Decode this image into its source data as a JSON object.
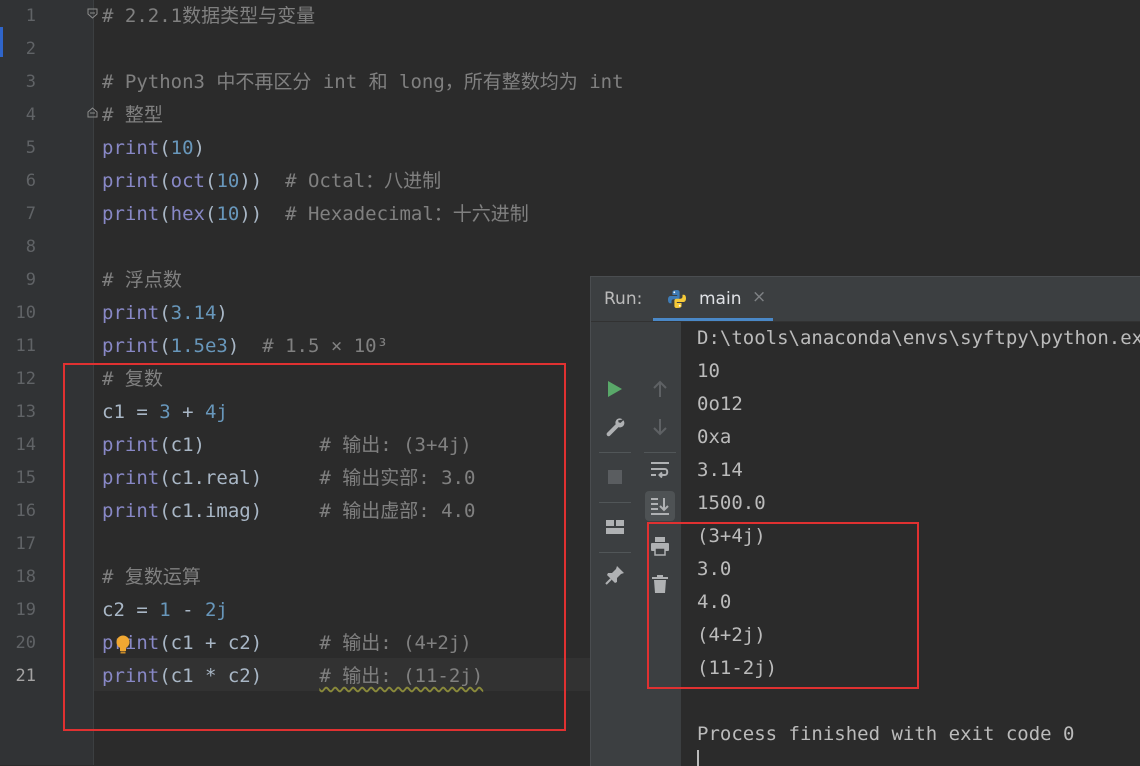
{
  "editor": {
    "line_numbers": [
      "1",
      "2",
      "3",
      "4",
      "5",
      "6",
      "7",
      "8",
      "9",
      "10",
      "11",
      "12",
      "13",
      "14",
      "15",
      "16",
      "17",
      "18",
      "19",
      "20",
      "21"
    ],
    "current_line": "21",
    "lines": [
      [
        {
          "t": "# 2.2.1数据类型与变量",
          "c": "cmt"
        }
      ],
      [],
      [
        {
          "t": "# Python3 中不再区分 int 和 long，所有整数均为 int",
          "c": "cmt"
        }
      ],
      [
        {
          "t": "# 整型",
          "c": "cmt"
        }
      ],
      [
        {
          "t": "print",
          "c": "kw"
        },
        {
          "t": "(",
          "c": "plain"
        },
        {
          "t": "10",
          "c": "num"
        },
        {
          "t": ")",
          "c": "plain"
        }
      ],
      [
        {
          "t": "print",
          "c": "kw"
        },
        {
          "t": "(",
          "c": "plain"
        },
        {
          "t": "oct",
          "c": "kw"
        },
        {
          "t": "(",
          "c": "plain"
        },
        {
          "t": "10",
          "c": "num"
        },
        {
          "t": "))  ",
          "c": "plain"
        },
        {
          "t": "# Octal：八进制",
          "c": "cmt"
        }
      ],
      [
        {
          "t": "print",
          "c": "kw"
        },
        {
          "t": "(",
          "c": "plain"
        },
        {
          "t": "hex",
          "c": "kw"
        },
        {
          "t": "(",
          "c": "plain"
        },
        {
          "t": "10",
          "c": "num"
        },
        {
          "t": "))  ",
          "c": "plain"
        },
        {
          "t": "# Hexadecimal：十六进制",
          "c": "cmt"
        }
      ],
      [],
      [
        {
          "t": "# 浮点数",
          "c": "cmt"
        }
      ],
      [
        {
          "t": "print",
          "c": "kw"
        },
        {
          "t": "(",
          "c": "plain"
        },
        {
          "t": "3.14",
          "c": "num"
        },
        {
          "t": ")",
          "c": "plain"
        }
      ],
      [
        {
          "t": "print",
          "c": "kw"
        },
        {
          "t": "(",
          "c": "plain"
        },
        {
          "t": "1.5e3",
          "c": "num"
        },
        {
          "t": ")  ",
          "c": "plain"
        },
        {
          "t": "# 1.5 × 10³",
          "c": "cmt"
        }
      ],
      [
        {
          "t": "# 复数",
          "c": "cmt"
        }
      ],
      [
        {
          "t": "c1 = ",
          "c": "plain"
        },
        {
          "t": "3",
          "c": "num"
        },
        {
          "t": " + ",
          "c": "plain"
        },
        {
          "t": "4j",
          "c": "num"
        }
      ],
      [
        {
          "t": "print",
          "c": "kw"
        },
        {
          "t": "(c1)          ",
          "c": "plain"
        },
        {
          "t": "# 输出: (3+4j)",
          "c": "cmt"
        }
      ],
      [
        {
          "t": "print",
          "c": "kw"
        },
        {
          "t": "(c1.real)     ",
          "c": "plain"
        },
        {
          "t": "# 输出实部: 3.0",
          "c": "cmt"
        }
      ],
      [
        {
          "t": "print",
          "c": "kw"
        },
        {
          "t": "(c1.imag)     ",
          "c": "plain"
        },
        {
          "t": "# 输出虚部: 4.0",
          "c": "cmt"
        }
      ],
      [],
      [
        {
          "t": "# 复数运算",
          "c": "cmt"
        }
      ],
      [
        {
          "t": "c2 = ",
          "c": "plain"
        },
        {
          "t": "1",
          "c": "num"
        },
        {
          "t": " - ",
          "c": "plain"
        },
        {
          "t": "2j",
          "c": "num"
        }
      ],
      [
        {
          "t": "print",
          "c": "kw"
        },
        {
          "t": "(c1 + c2)     ",
          "c": "plain"
        },
        {
          "t": "# 输出: (4+2j)",
          "c": "cmt"
        }
      ],
      [
        {
          "t": "print",
          "c": "kw"
        },
        {
          "t": "(c1 * c2)     ",
          "c": "plain"
        },
        {
          "t": "# 输出: (11-2j)",
          "c": "cmt squiggle"
        }
      ]
    ]
  },
  "run_panel": {
    "label": "Run:",
    "tab_name": "main",
    "tab_close": "×",
    "output": [
      "D:\\tools\\anaconda\\envs\\syftpy\\python.exe",
      "10",
      "0o12",
      "0xa",
      "3.14",
      "1500.0",
      "(3+4j)",
      "3.0",
      "4.0",
      "(4+2j)",
      "(11-2j)",
      "",
      "Process finished with exit code 0"
    ]
  },
  "colors": {
    "editor_bg": "#2b2b2b",
    "keyword": "#8888c6",
    "number": "#6897bb",
    "comment": "#808080",
    "highlight_box": "#e03131",
    "run_green": "#59a869",
    "tab_accent": "#4a88c7"
  },
  "icons": [
    "fold-marker-icon",
    "lightbulb-icon",
    "python-icon",
    "close-icon",
    "run-icon",
    "up-arrow-icon",
    "down-arrow-icon",
    "wrench-icon",
    "soft-wrap-icon",
    "stop-icon",
    "scroll-to-end-icon",
    "layout-icon",
    "print-icon",
    "pin-icon",
    "trash-icon"
  ]
}
